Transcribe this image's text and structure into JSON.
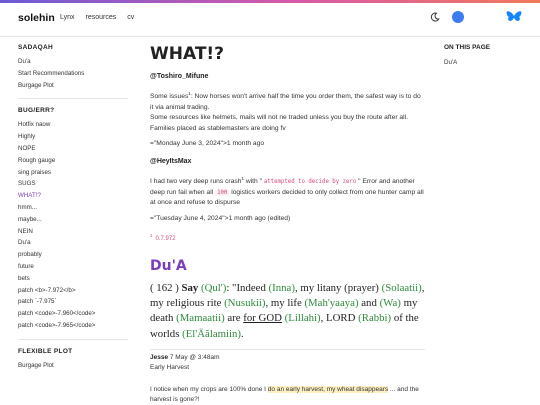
{
  "header": {
    "logo": "solehin",
    "nav": [
      "Lynx",
      "resources",
      "cv"
    ]
  },
  "sidebar": {
    "sections": [
      {
        "title": "SADAQAH",
        "items": [
          "Du'a",
          "Start Recommendations",
          "Burgage Plot"
        ]
      },
      {
        "title": "BUG/ERR?",
        "items": [
          "Hotfix naow",
          "Highly",
          "NOPE",
          "Rough gauge",
          "sing praises",
          "SUGS",
          "WHAT!?",
          "hmm...",
          "maybe...",
          "NEIN",
          "Du'a",
          "probably",
          "future",
          "bets",
          "patch <b>-7.972</b>",
          "patch `-7.975`",
          "patch <code>-7.960</code>",
          "patch <code>-7.965</code>"
        ],
        "active": "WHAT!?"
      },
      {
        "title": "FLEXIBLE PLOT",
        "items": [
          "Burgage Plot"
        ]
      }
    ]
  },
  "main": {
    "title": "WHAT!?",
    "post1": {
      "author": "@Toshiro_Mifune",
      "line1a": "Some issues",
      "line1sup": "1",
      "line1b": ": Now horses won't arrive half the time you order them, the safest way is to do it via animal trading.",
      "line2": "Some resources like helmets,   mails will not ne traded unless you buy the route after all. Families placed as stablemasters are doing fv",
      "time": "=\"Monday June 3, 2024\">1 month ago"
    },
    "post2": {
      "author": "@HeyItsMax",
      "text_a": "I had two very deep runs crash",
      "text_sup": "1",
      "text_b": " with \" ",
      "code1": "attempted to decide by zero",
      "text_c": " \" Error and another deep run fail when all ",
      "code2": "100",
      "text_d": " logistics workers decided to only collect from one hunter camp all at once and refuse to dispurse",
      "time": "=\"Tuesday June 4, 2024\">1 month ago (edited)",
      "footnote_num": "1",
      "footnote_text": "0.7.972"
    },
    "dua": {
      "heading": "Du'A",
      "num": "( 162 )",
      "say": "Say",
      "say_tr": "(Qul')",
      "t1": ": \"Indeed ",
      "inna": "(Inna)",
      "t2": ", my litany (prayer) ",
      "solaatii": "(Solaatii)",
      "t3": ", my religious rite ",
      "nusukii": "(Nusukii)",
      "t4": ", my life ",
      "mahyaaya": "(Mah'yaaya)",
      "t5": " and ",
      "wa": "(Wa)",
      "t6": " my death ",
      "mamaatii": "(Mamaatii)",
      "t7": " are ",
      "forgod": "for GOD",
      "lillahi": "(Lillahi)",
      "t8": ", LORD ",
      "rabbi": "(Rabbi)",
      "t9": " of the worlds ",
      "alamiin": "(El'Äãlamiin)",
      "t10": "."
    },
    "comment": {
      "name": "Jesse",
      "date": "7 May @ 3:48am",
      "subtitle": "Early Harvest",
      "body_a": "I notice when my crops are 100% done I ",
      "body_hl1": "do an early harvest, my wheat disappears",
      "body_b": " ... and the harvest is gone?!"
    }
  },
  "toc": {
    "title": "ON THIS PAGE",
    "items": [
      "Du'A"
    ]
  },
  "colors": {
    "accent": "#7a3fb8",
    "green": "#2e8b3e",
    "code": "#d64a7a",
    "toggle": "#3d7bf0"
  }
}
